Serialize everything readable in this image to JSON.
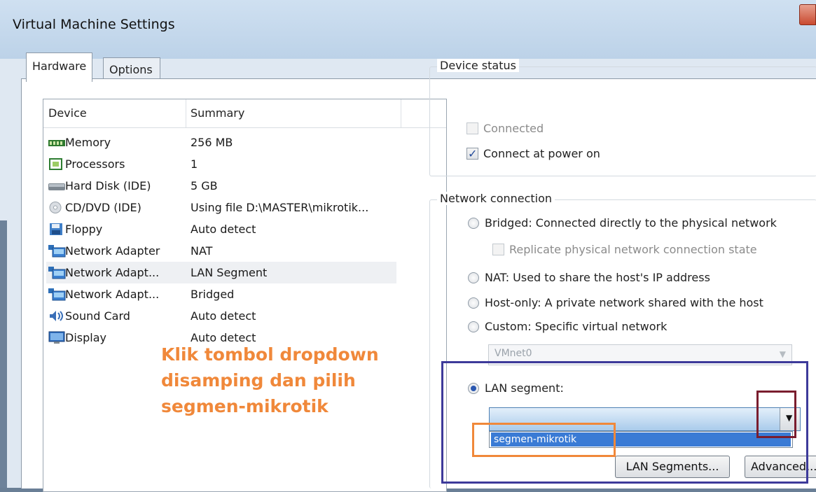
{
  "window": {
    "title": "Virtual Machine Settings"
  },
  "tabs": [
    {
      "label": "Hardware",
      "active": true
    },
    {
      "label": "Options",
      "active": false
    }
  ],
  "device_list": {
    "columns": [
      "Device",
      "Summary"
    ],
    "rows": [
      {
        "icon": "memory-icon",
        "device": "Memory",
        "summary": "256 MB"
      },
      {
        "icon": "processor-icon",
        "device": "Processors",
        "summary": "1"
      },
      {
        "icon": "hard-disk-icon",
        "device": "Hard Disk (IDE)",
        "summary": "5 GB"
      },
      {
        "icon": "cd-dvd-icon",
        "device": "CD/DVD (IDE)",
        "summary": "Using file D:\\MASTER\\mikrotik..."
      },
      {
        "icon": "floppy-icon",
        "device": "Floppy",
        "summary": "Auto detect"
      },
      {
        "icon": "network-adapter-icon",
        "device": "Network Adapter",
        "summary": "NAT"
      },
      {
        "icon": "network-adapter-icon",
        "device": "Network Adapt...",
        "summary": "LAN Segment",
        "selected": true
      },
      {
        "icon": "network-adapter-icon",
        "device": "Network Adapt...",
        "summary": "Bridged"
      },
      {
        "icon": "sound-card-icon",
        "device": "Sound Card",
        "summary": "Auto detect"
      },
      {
        "icon": "display-icon",
        "device": "Display",
        "summary": "Auto detect"
      }
    ]
  },
  "annotation": {
    "lines": [
      "Klik tombol dropdown",
      "disamping dan pilih",
      "segmen-mikrotik"
    ],
    "color": "#f0883a"
  },
  "device_status": {
    "label": "Device status",
    "connected": {
      "label": "Connected",
      "checked": false,
      "disabled": true
    },
    "connect_at_power_on": {
      "label": "Connect at power on",
      "checked": true
    }
  },
  "network_connection": {
    "label": "Network connection",
    "bridged": "Bridged: Connected directly to the physical network",
    "replicate": "Replicate physical network connection state",
    "nat": "NAT: Used to share the host's IP address",
    "host_only": "Host-only: A private network shared with the host",
    "custom": "Custom: Specific virtual network",
    "vmnet_value": "VMnet0",
    "lan_segment": "LAN segment:",
    "selected": "lan_segment",
    "lan_dropdown_option": "segmen-mikrotik",
    "lan_segments_button": "LAN Segments...",
    "advanced_button": "Advanced..."
  },
  "highlight_colors": {
    "blue": "#3d3a9a",
    "maroon": "#7a1d2e",
    "orange": "#f0883a"
  }
}
